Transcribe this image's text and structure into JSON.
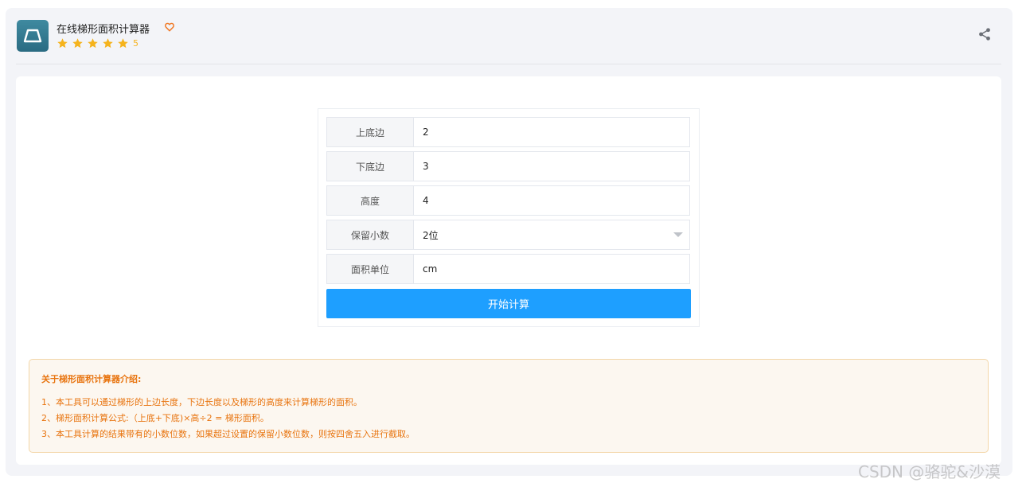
{
  "app": {
    "title": "在线梯形面积计算器",
    "rating": "5",
    "icon": "trapezoid-icon",
    "favorite_icon": "heart-outline-icon",
    "share_icon": "share-icon"
  },
  "form": {
    "rows": [
      {
        "label": "上底边",
        "value": "2"
      },
      {
        "label": "下底边",
        "value": "3"
      },
      {
        "label": "高度",
        "value": "4"
      },
      {
        "label": "保留小数",
        "value": "2位"
      },
      {
        "label": "面积单位",
        "value": "cm"
      }
    ],
    "button_label": "开始计算"
  },
  "intro": {
    "title": "关于梯形面积计算器介绍:",
    "lines": [
      "1、本工具可以通过梯形的上边长度，下边长度以及梯形的高度来计算梯形的面积。",
      "2、梯形面积计算公式:（上底+下底)×高÷2 = 梯形面积。",
      "3、本工具计算的结果带有的小数位数，如果超过设置的保留小数位数，则按四舍五入进行截取。"
    ]
  },
  "watermark": "CSDN @骆驼&沙漠",
  "colors": {
    "accent": "#1e9fff",
    "star": "#f5b31d",
    "favorite": "#f07b2a",
    "intro_text": "#e8740f"
  }
}
